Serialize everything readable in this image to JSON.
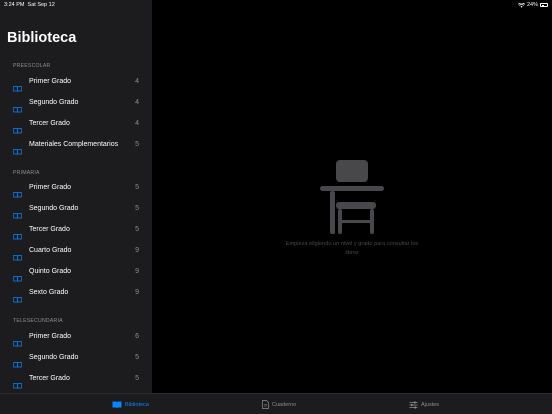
{
  "status": {
    "time": "3:24 PM",
    "date": "Sat Sep 12",
    "battery": "24%"
  },
  "sidebar": {
    "title": "Biblioteca",
    "sections": [
      {
        "header": "PREESCOLAR",
        "items": [
          {
            "label": "Primer Grado",
            "count": "4"
          },
          {
            "label": "Segundo Grado",
            "count": "4"
          },
          {
            "label": "Tercer Grado",
            "count": "4"
          },
          {
            "label": "Materiales Complementarios",
            "count": "5"
          }
        ]
      },
      {
        "header": "PRIMARIA",
        "items": [
          {
            "label": "Primer Grado",
            "count": "5"
          },
          {
            "label": "Segundo Grado",
            "count": "5"
          },
          {
            "label": "Tercer Grado",
            "count": "5"
          },
          {
            "label": "Cuarto Grado",
            "count": "9"
          },
          {
            "label": "Quinto Grado",
            "count": "9"
          },
          {
            "label": "Sexto Grado",
            "count": "9"
          }
        ]
      },
      {
        "header": "TELESECUNDARIA",
        "items": [
          {
            "label": "Primer Grado",
            "count": "6"
          },
          {
            "label": "Segundo Grado",
            "count": "5"
          },
          {
            "label": "Tercer Grado",
            "count": "5"
          }
        ]
      }
    ]
  },
  "main": {
    "empty_message": "Empieza eligiendo un nivel y grado para consultar los libros",
    "empty_icon": "school-desk-icon"
  },
  "tabbar": {
    "tabs": [
      {
        "label": "Biblioteca",
        "icon": "book-icon",
        "active": true
      },
      {
        "label": "Cuaderno",
        "icon": "document-icon",
        "active": false
      },
      {
        "label": "Ajustes",
        "icon": "sliders-icon",
        "active": false
      }
    ]
  },
  "colors": {
    "accent": "#0a84ff",
    "sidebar_bg": "#1c1c1e",
    "main_bg": "#000000",
    "secondary_text": "#8e8e93"
  }
}
